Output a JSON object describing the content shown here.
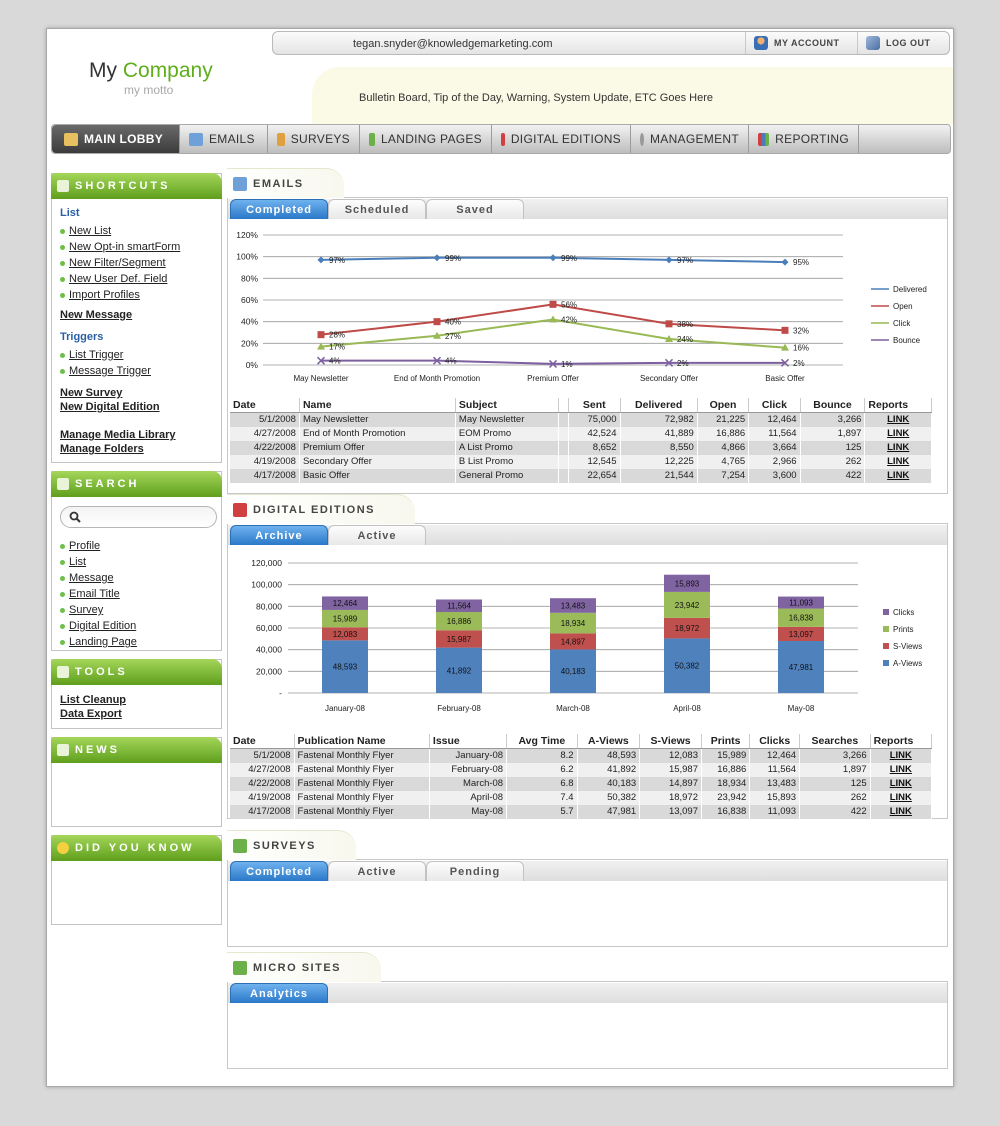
{
  "header": {
    "logo_my": "My",
    "logo_company": "Company",
    "motto": "my motto",
    "email": "tegan.snyder@knowledgemarketing.com",
    "my_account": "MY ACCOUNT",
    "log_out": "LOG OUT",
    "bulletin": "Bulletin Board, Tip of the Day, Warning, System Update, ETC Goes Here"
  },
  "nav": [
    "MAIN LOBBY",
    "EMAILS",
    "SURVEYS",
    "LANDING PAGES",
    "DIGITAL EDITIONS",
    "MANAGEMENT",
    "REPORTING"
  ],
  "sidebar": {
    "shortcuts_title": "SHORTCUTS",
    "list_title": "List",
    "list_items": [
      "New List",
      "New Opt-in smartForm",
      "New Filter/Segment",
      "New User Def. Field",
      "Import Profiles"
    ],
    "new_message": "New Message",
    "triggers_title": "Triggers",
    "trigger_items": [
      "List Trigger",
      "Message Trigger"
    ],
    "new_survey": "New Survey",
    "new_digital_edition": "New Digital Edition",
    "manage_media": "Manage Media Library",
    "manage_folders": "Manage Folders",
    "search_title": "SEARCH",
    "search_items": [
      "Profile",
      "List",
      "Message",
      "Email Title",
      "Survey",
      "Digital Edition",
      "Landing Page"
    ],
    "tools_title": "TOOLS",
    "tools_items": [
      "List Cleanup",
      "Data Export"
    ],
    "news_title": "NEWS",
    "dyk_title": "DID YOU KNOW"
  },
  "emails": {
    "title": "EMAILS",
    "tabs": [
      "Completed",
      "Scheduled",
      "Saved"
    ],
    "columns": [
      "Date",
      "Name",
      "Subject",
      "",
      "Sent",
      "Delivered",
      "Open",
      "Click",
      "Bounce",
      "Reports"
    ],
    "rows": [
      [
        "5/1/2008",
        "May Newsletter",
        "May Newsletter",
        "",
        "75,000",
        "72,982",
        "21,225",
        "12,464",
        "3,266",
        "LINK"
      ],
      [
        "4/27/2008",
        "End of Month Promotion",
        "EOM Promo",
        "",
        "42,524",
        "41,889",
        "16,886",
        "11,564",
        "1,897",
        "LINK"
      ],
      [
        "4/22/2008",
        "Premium Offer",
        "A List Promo",
        "",
        "8,652",
        "8,550",
        "4,866",
        "3,664",
        "125",
        "LINK"
      ],
      [
        "4/19/2008",
        "Secondary Offer",
        "B List Promo",
        "",
        "12,545",
        "12,225",
        "4,765",
        "2,966",
        "262",
        "LINK"
      ],
      [
        "4/17/2008",
        "Basic Offer",
        "General Promo",
        "",
        "22,654",
        "21,544",
        "7,254",
        "3,600",
        "422",
        "LINK"
      ]
    ]
  },
  "digital": {
    "title": "DIGITAL EDITIONS",
    "tabs": [
      "Archive",
      "Active"
    ],
    "columns": [
      "Date",
      "Publication Name",
      "Issue",
      "Avg Time",
      "A-Views",
      "S-Views",
      "Prints",
      "Clicks",
      "Searches",
      "Reports"
    ],
    "rows": [
      [
        "5/1/2008",
        "Fastenal Monthly Flyer",
        "January-08",
        "8.2",
        "48,593",
        "12,083",
        "15,989",
        "12,464",
        "3,266",
        "LINK"
      ],
      [
        "4/27/2008",
        "Fastenal Monthly Flyer",
        "February-08",
        "6.2",
        "41,892",
        "15,987",
        "16,886",
        "11,564",
        "1,897",
        "LINK"
      ],
      [
        "4/22/2008",
        "Fastenal Monthly Flyer",
        "March-08",
        "6.8",
        "40,183",
        "14,897",
        "18,934",
        "13,483",
        "125",
        "LINK"
      ],
      [
        "4/19/2008",
        "Fastenal Monthly Flyer",
        "April-08",
        "7.4",
        "50,382",
        "18,972",
        "23,942",
        "15,893",
        "262",
        "LINK"
      ],
      [
        "4/17/2008",
        "Fastenal Monthly Flyer",
        "May-08",
        "5.7",
        "47,981",
        "13,097",
        "16,838",
        "11,093",
        "422",
        "LINK"
      ]
    ]
  },
  "surveys": {
    "title": "SURVEYS",
    "tabs": [
      "Completed",
      "Active",
      "Pending"
    ]
  },
  "micro": {
    "title": "MICRO SITES",
    "tabs": [
      "Analytics"
    ]
  },
  "chart_data": [
    {
      "type": "line",
      "categories": [
        "May Newsletter",
        "End of Month Promotion",
        "Premium Offer",
        "Secondary Offer",
        "Basic Offer"
      ],
      "series": [
        {
          "name": "Delivered",
          "values": [
            97,
            99,
            99,
            97,
            95
          ],
          "labels": [
            "97%",
            "99%",
            "99%",
            "97%",
            "95%"
          ],
          "color": "#4a7ebb"
        },
        {
          "name": "Open",
          "values": [
            28,
            40,
            56,
            38,
            32
          ],
          "labels": [
            "28%",
            "40%",
            "56%",
            "38%",
            "32%"
          ],
          "color": "#be4b48"
        },
        {
          "name": "Click",
          "values": [
            17,
            27,
            42,
            24,
            16
          ],
          "labels": [
            "17%",
            "27%",
            "42%",
            "24%",
            "16%"
          ],
          "color": "#98b954"
        },
        {
          "name": "Bounce",
          "values": [
            4,
            4,
            1,
            2,
            2
          ],
          "labels": [
            "4%",
            "4%",
            "1%",
            "2%",
            "2%"
          ],
          "color": "#7d60a0"
        }
      ],
      "yticks": [
        "0%",
        "20%",
        "40%",
        "60%",
        "80%",
        "100%",
        "120%"
      ],
      "ylim": [
        0,
        120
      ],
      "legend": "right"
    },
    {
      "type": "bar",
      "stacked": true,
      "categories": [
        "January-08",
        "February-08",
        "March-08",
        "April-08",
        "May-08"
      ],
      "series": [
        {
          "name": "A-Views",
          "values": [
            48593,
            41892,
            40183,
            50382,
            47981
          ],
          "labels": [
            "48,593",
            "41,892",
            "40,183",
            "50,382",
            "47,981"
          ],
          "color": "#4f81bd"
        },
        {
          "name": "S-Views",
          "values": [
            12083,
            15987,
            14897,
            18972,
            13097
          ],
          "labels": [
            "12,083",
            "15,987",
            "14,897",
            "18,972",
            "13,097"
          ],
          "color": "#c0504d"
        },
        {
          "name": "Prints",
          "values": [
            15989,
            16886,
            18934,
            23942,
            16838
          ],
          "labels": [
            "15,989",
            "16,886",
            "18,934",
            "23,942",
            "16,838"
          ],
          "color": "#9bbb59"
        },
        {
          "name": "Clicks",
          "values": [
            12464,
            11564,
            13483,
            15893,
            11093
          ],
          "labels": [
            "12,464",
            "11,564",
            "13,483",
            "15,893",
            "11,093"
          ],
          "color": "#8064a2"
        }
      ],
      "yticks": [
        "-",
        "20,000",
        "40,000",
        "60,000",
        "80,000",
        "100,000",
        "120,000"
      ],
      "ylim": [
        0,
        120000
      ],
      "legend": "right"
    }
  ]
}
